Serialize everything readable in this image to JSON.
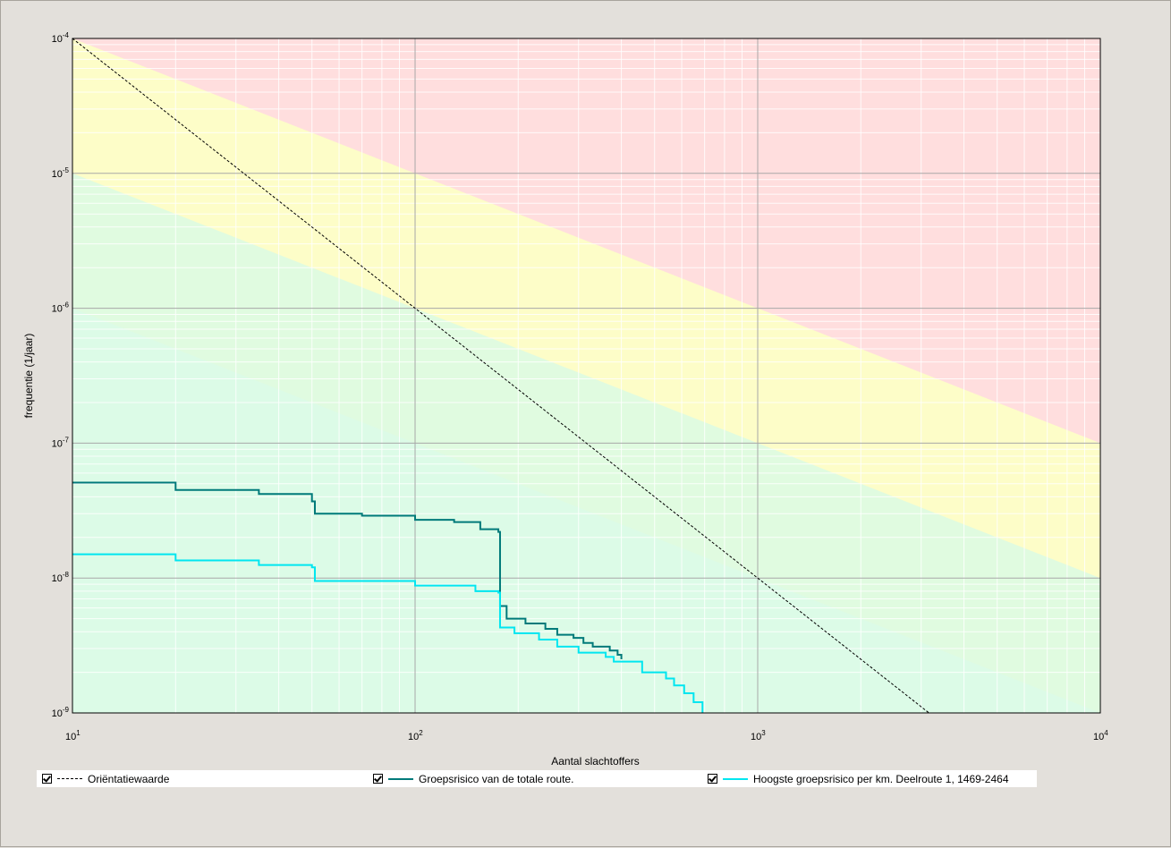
{
  "chart_data": {
    "type": "line",
    "xlabel": "Aantal slachtoffers",
    "ylabel": "frequentie (1/jaar)",
    "xscale": "log",
    "yscale": "log",
    "xlim": [
      10,
      10000
    ],
    "ylim": [
      1e-09,
      0.0001
    ],
    "grid": true,
    "legend_position": "bottom",
    "x_tick_labels": [
      {
        "base": "10",
        "exp": "1"
      },
      {
        "base": "10",
        "exp": "2"
      },
      {
        "base": "10",
        "exp": "3"
      },
      {
        "base": "10",
        "exp": "4"
      }
    ],
    "y_tick_labels": [
      {
        "base": "10",
        "exp": "-4"
      },
      {
        "base": "10",
        "exp": "-5"
      },
      {
        "base": "10",
        "exp": "-6"
      },
      {
        "base": "10",
        "exp": "-7"
      },
      {
        "base": "10",
        "exp": "-8"
      },
      {
        "base": "10",
        "exp": "-9"
      }
    ],
    "zone_colors": {
      "above_orientation": "#ffdede",
      "between": "#fdfdc8",
      "below": "#e0fbe0",
      "below_cyan_tint": "#dcfbe8"
    },
    "series": [
      {
        "name": "Oriëntatiewaarde",
        "color": "#000000",
        "style": "dashed",
        "points": [
          [
            10,
            0.0001
          ],
          [
            3162,
            1e-09
          ]
        ]
      },
      {
        "name": "Groepsrisico van de totale route.",
        "color": "#007a7a",
        "style": "step",
        "points": [
          [
            10,
            5.1e-08
          ],
          [
            20,
            4.5e-08
          ],
          [
            35,
            4.2e-08
          ],
          [
            50,
            3.7e-08
          ],
          [
            51,
            3e-08
          ],
          [
            70,
            2.9e-08
          ],
          [
            100,
            2.7e-08
          ],
          [
            130,
            2.6e-08
          ],
          [
            155,
            2.3e-08
          ],
          [
            175,
            2.2e-08
          ],
          [
            177,
            6.2e-09
          ],
          [
            185,
            5e-09
          ],
          [
            210,
            4.6e-09
          ],
          [
            240,
            4.2e-09
          ],
          [
            260,
            3.8e-09
          ],
          [
            290,
            3.6e-09
          ],
          [
            310,
            3.3e-09
          ],
          [
            330,
            3.1e-09
          ],
          [
            370,
            2.9e-09
          ],
          [
            390,
            2.7e-09
          ],
          [
            400,
            2.5e-09
          ]
        ]
      },
      {
        "name": "Hoogste groepsrisico per km. Deelroute 1, 1469-2464",
        "color": "#00e6f0",
        "style": "step",
        "points": [
          [
            10,
            1.5e-08
          ],
          [
            20,
            1.35e-08
          ],
          [
            35,
            1.25e-08
          ],
          [
            50,
            1.2e-08
          ],
          [
            51,
            9.5e-09
          ],
          [
            100,
            8.8e-09
          ],
          [
            150,
            8e-09
          ],
          [
            175,
            7.8e-09
          ],
          [
            177,
            4.3e-09
          ],
          [
            195,
            3.9e-09
          ],
          [
            230,
            3.5e-09
          ],
          [
            260,
            3.1e-09
          ],
          [
            300,
            2.8e-09
          ],
          [
            360,
            2.6e-09
          ],
          [
            380,
            2.4e-09
          ],
          [
            440,
            2.4e-09
          ],
          [
            460,
            2e-09
          ],
          [
            540,
            1.8e-09
          ],
          [
            570,
            1.6e-09
          ],
          [
            610,
            1.4e-09
          ],
          [
            650,
            1.2e-09
          ],
          [
            690,
            1e-09
          ]
        ]
      }
    ]
  },
  "legend": {
    "items": [
      {
        "label": "Oriëntatiewaarde"
      },
      {
        "label": "Groepsrisico van de totale route."
      },
      {
        "label": "Hoogste groepsrisico per km. Deelroute 1, 1469-2464"
      }
    ]
  }
}
